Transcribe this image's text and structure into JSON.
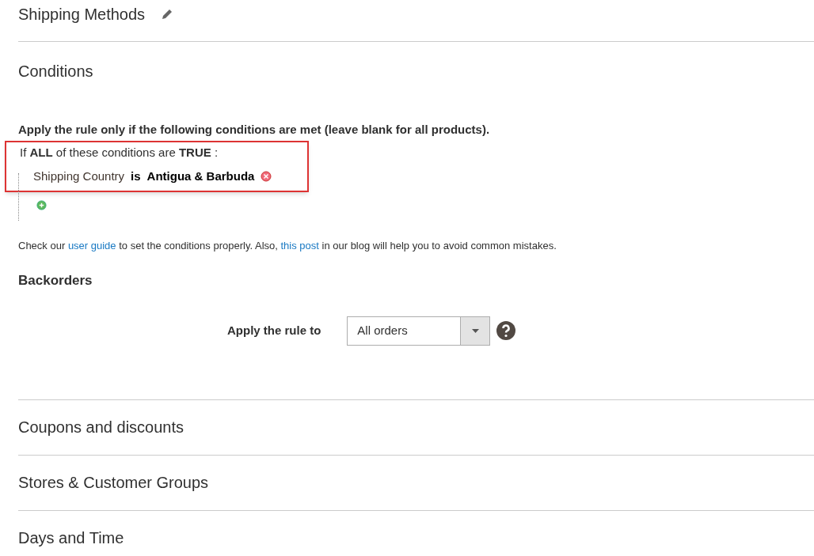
{
  "top_section": {
    "title": "Shipping Methods"
  },
  "conditions": {
    "title": "Conditions",
    "intro": "Apply the rule only if the following conditions are met (leave blank for all products).",
    "aggregator": "If **ALL**  of these conditions are **TRUE** :",
    "highlighted": true,
    "rows": [
      {
        "attribute": "Shipping Country",
        "operator": "is",
        "value": "Antigua & Barbuda"
      }
    ],
    "help": [
      {
        "kind": "text",
        "text": "Check our "
      },
      {
        "kind": "link",
        "text": "user guide"
      },
      {
        "kind": "text",
        "text": " to set the conditions properly. Also, "
      },
      {
        "kind": "link",
        "text": "this post"
      },
      {
        "kind": "text",
        "text": " in our blog will help you to avoid common mistakes."
      }
    ]
  },
  "backorders": {
    "title": "Backorders",
    "label": "Apply the rule to",
    "value": "All orders"
  },
  "sections": [
    {
      "title": "Coupons and discounts"
    },
    {
      "title": "Stores & Customer Groups"
    },
    {
      "title": "Days and Time"
    }
  ]
}
